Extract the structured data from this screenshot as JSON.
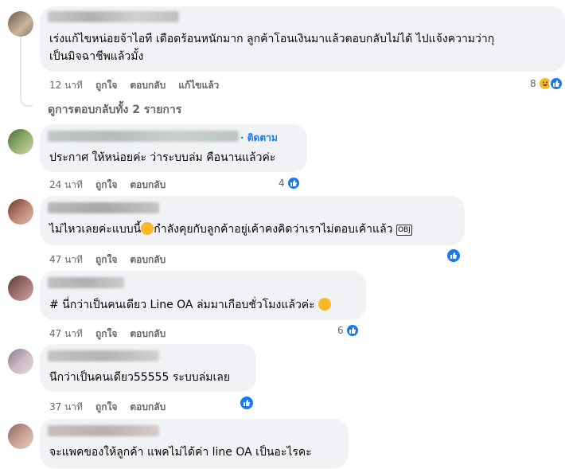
{
  "comments": [
    {
      "text_line1": "เร่งแก้ไขหน่อยจ้าไอที เดือดร้อนหนักมาก ลูกค้าโอนเงินมาแล้วตอบกลับไม่ได้ ไปแจ้งความว่ากุ",
      "text_line2": "เป็นมิจฉาชีพแล้วมั้ง",
      "time": "12 นาที",
      "like": "ถูกใจ",
      "reply": "ตอบกลับ",
      "edit": "แก้ไขแล้ว",
      "reaction_count": "8",
      "reaction_icons": [
        "haha-icon",
        "like-icon"
      ]
    },
    {
      "follow": "· ติดตาม",
      "text_line1": "ประกาศ ให้หน่อยค่ะ ว่าระบบล่ม คือนานแล้วค่ะ",
      "time": "24 นาที",
      "like": "ถูกใจ",
      "reply": "ตอบกลับ",
      "reaction_count": "4",
      "reaction_icons": [
        "like-icon"
      ]
    },
    {
      "text_line1_a": "ไม่ไหวเลยค่ะแบบนี้",
      "text_line1_b": "กำลังคุยกับลูกค้าอยู่เค้าคงคิดว่าเราไม่ตอบเค้าแล้ว",
      "obj_tag": "OBJ",
      "time": "47 นาที",
      "like": "ถูกใจ",
      "reply": "ตอบกลับ",
      "reaction_count": "",
      "reaction_icons": [
        "like-icon"
      ]
    },
    {
      "text_line1": "# นี่กว่าเป็นคนเดียว Line OA ล่มมาเกือบชั่วโมงแล้วค่ะ",
      "time": "47 นาที",
      "like": "ถูกใจ",
      "reply": "ตอบกลับ",
      "reaction_count": "6",
      "reaction_icons": [
        "like-icon"
      ]
    },
    {
      "text_line1": "นึกว่าเป็นคนเดียว55555 ระบบล่มเลย",
      "time": "37 นาที",
      "like": "ถูกใจ",
      "reply": "ตอบกลับ",
      "reaction_count": "",
      "reaction_icons": [
        "like-icon"
      ]
    },
    {
      "text_line1": "จะแพคของให้ลูกค้า แพคไม่ได้ค่า line OA เป็นอะไรคะ"
    }
  ],
  "view_replies": "ดูการตอบกลับทั้ง 2 รายการ",
  "colors": {
    "bubble": "#f0f2f5",
    "action_text": "#65676b",
    "like_blue": "#1877f2",
    "haha_yellow": "#f7b928"
  }
}
